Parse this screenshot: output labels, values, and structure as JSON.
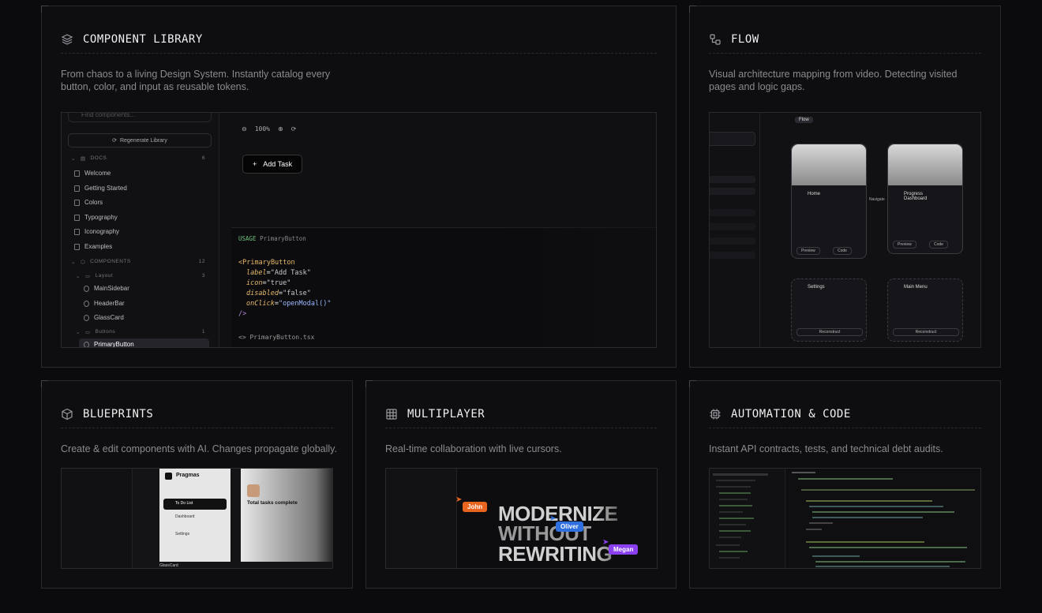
{
  "cards": {
    "component_library": {
      "title": "COMPONENT LIBRARY",
      "description_line1": "From chaos to a living Design System. Instantly catalog every",
      "description_line2": "button, color, and input as reusable tokens.",
      "icon": "layers-icon"
    },
    "flow": {
      "title": "FLOW",
      "description_line1": "Visual architecture mapping from video. Detecting visited",
      "description_line2": "pages and logic gaps.",
      "icon": "flow-nodes-icon"
    },
    "blueprints": {
      "title": "BLUEPRINTS",
      "description": "Create & edit components with AI. Changes propagate globally.",
      "icon": "cube-icon"
    },
    "multiplayer": {
      "title": "MULTIPLAYER",
      "description": "Real-time collaboration with live cursors.",
      "icon": "grid-icon"
    },
    "automation": {
      "title": "AUTOMATION & CODE",
      "description": "Instant API contracts, tests, and technical debt audits.",
      "icon": "chip-icon"
    }
  },
  "library_preview": {
    "search_placeholder": "Find components...",
    "regenerate_label": "Regenerate Library",
    "docs_section": "DOCS",
    "docs_count": "6",
    "docs_items": [
      "Welcome",
      "Getting Started",
      "Colors",
      "Typography",
      "Iconography",
      "Examples"
    ],
    "components_section": "COMPONENTS",
    "components_count": "12",
    "layout_group": "Layout",
    "layout_count": "3",
    "layout_items": [
      "MainSidebar",
      "HeaderBar",
      "GlassCard"
    ],
    "buttons_group": "Buttons",
    "buttons_count": "1",
    "active_item": "PrimaryButton",
    "zoom": "100%",
    "add_task_label": "Add Task",
    "usage_label": "USAGE",
    "usage_component": "PrimaryButton",
    "code": {
      "open": "<PrimaryButton",
      "l1_attr": "label",
      "l1_val": "\"Add Task\"",
      "l2_attr": "icon",
      "l2_val": "\"true\"",
      "l3_attr": "disabled",
      "l3_val": "\"false\"",
      "l4_attr": "onClick",
      "l4_val": "\"openModal()\"",
      "close": "/>"
    },
    "file_name": "PrimaryButton.tsx"
  },
  "flow_preview": {
    "flow_tab": "Flow",
    "node_home": "Home",
    "node_dashboard": "Progress Dashboard",
    "node_settings": "Settings",
    "node_menu": "Main Menu",
    "preview_label": "Preview",
    "code_label": "Code",
    "navigate_label": "Navigate",
    "reconstruct_label": "Reconstruct"
  },
  "blueprints_preview": {
    "app_name": "Pragmas",
    "nav_active": "To Do List",
    "nav_2": "Dashboard",
    "nav_3": "Settings",
    "headline": "Total tasks complete",
    "glass_card": "GlassCard"
  },
  "multiplayer_preview": {
    "headline_1": "MODERNIZE",
    "headline_2": "WITHOUT",
    "headline_3": "REWRITING",
    "cursors": [
      {
        "name": "John",
        "color": "#e8651f"
      },
      {
        "name": "Oliver",
        "color": "#2f6fdf"
      },
      {
        "name": "Megan",
        "color": "#8a3ff0"
      }
    ]
  }
}
